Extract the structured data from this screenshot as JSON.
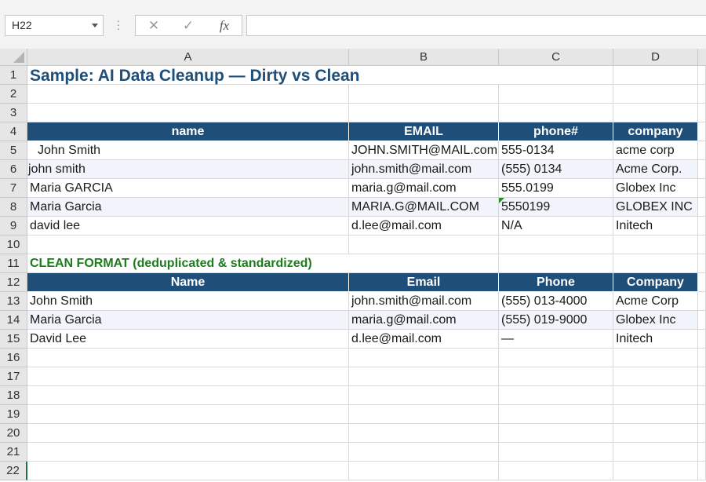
{
  "formula_bar": {
    "name_box": "H22",
    "cancel_symbol": "✕",
    "enter_symbol": "✓",
    "fx_label": "fx",
    "formula_value": ""
  },
  "columns": [
    "A",
    "B",
    "C",
    "D"
  ],
  "rows": {
    "r1": {
      "num": "1",
      "title": "Sample: AI Data Cleanup — Dirty vs Clean"
    },
    "r2": {
      "num": "2"
    },
    "r3": {
      "num": "3"
    },
    "r4": {
      "num": "4",
      "a": "name",
      "b": "EMAIL",
      "c": "phone#",
      "d": "company"
    },
    "r5": {
      "num": "5",
      "a": "John Smith",
      "b": "JOHN.SMITH@MAIL.com",
      "c": "555-0134",
      "d": "acme corp"
    },
    "r6": {
      "num": "6",
      "a": "john smith",
      "b": "john.smith@mail.com",
      "c": "(555) 0134",
      "d": "Acme Corp."
    },
    "r7": {
      "num": "7",
      "a": "Maria GARCIA",
      "b": "maria.g@mail.com",
      "c": "555.0199",
      "d": "Globex Inc"
    },
    "r8": {
      "num": "8",
      "a": "Maria Garcia",
      "b": "MARIA.G@MAIL.COM",
      "c": "5550199",
      "d": "GLOBEX INC"
    },
    "r9": {
      "num": "9",
      "a": "david lee",
      "b": "d.lee@mail.com",
      "c": "N/A",
      "d": "Initech"
    },
    "r10": {
      "num": "10"
    },
    "r11": {
      "num": "11",
      "section": "CLEAN FORMAT (deduplicated & standardized)"
    },
    "r12": {
      "num": "12",
      "a": "Name",
      "b": "Email",
      "c": "Phone",
      "d": "Company"
    },
    "r13": {
      "num": "13",
      "a": "John Smith",
      "b": "john.smith@mail.com",
      "c": "(555) 013-4000",
      "d": "Acme Corp"
    },
    "r14": {
      "num": "14",
      "a": "Maria Garcia",
      "b": "maria.g@mail.com",
      "c": "(555) 019-9000",
      "d": "Globex Inc"
    },
    "r15": {
      "num": "15",
      "a": "David Lee",
      "b": "d.lee@mail.com",
      "c": "—",
      "d": "Initech"
    },
    "r16": {
      "num": "16"
    },
    "r17": {
      "num": "17"
    },
    "r18": {
      "num": "18"
    },
    "r19": {
      "num": "19"
    },
    "r20": {
      "num": "20"
    },
    "r21": {
      "num": "21"
    },
    "r22": {
      "num": "22"
    }
  },
  "colors": {
    "header_fill": "#1f4e79",
    "header_text": "#ffffff",
    "title_text": "#1f4e79",
    "section_text": "#1e7b1e",
    "alt_row_fill": "#f2f4fb",
    "error_indicator": "#2e8b2e"
  }
}
